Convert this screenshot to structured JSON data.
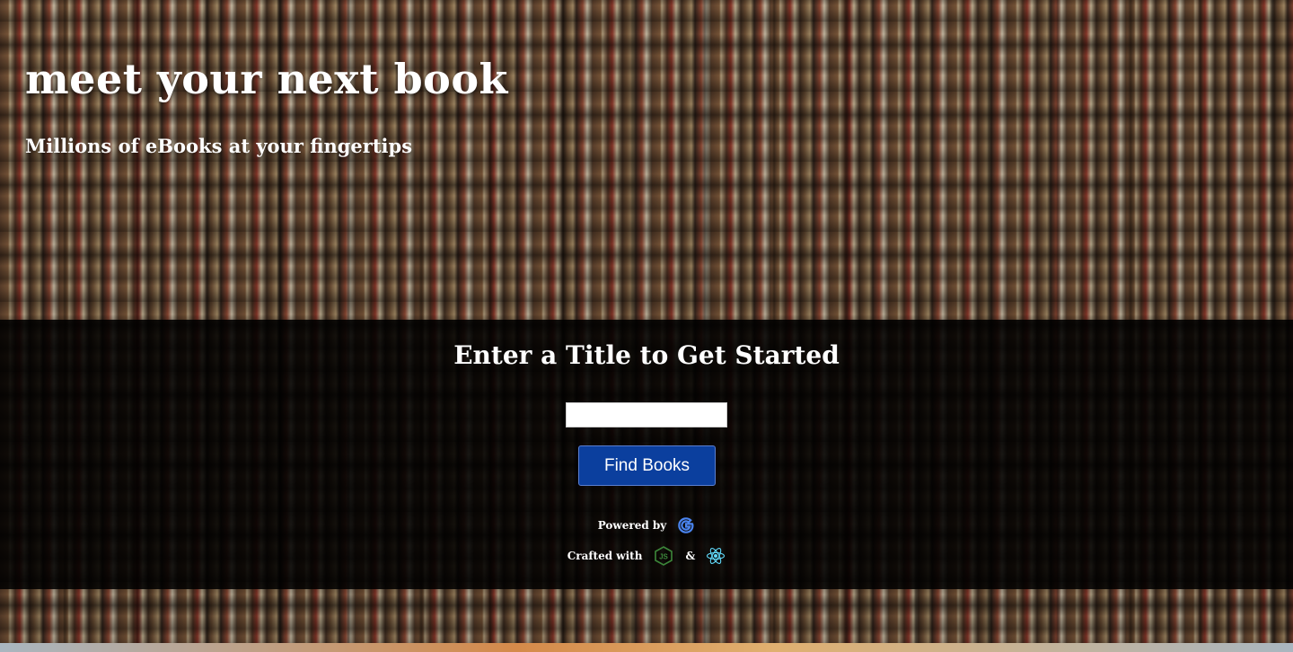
{
  "hero": {
    "title": "meet your next book",
    "subtitle": "Millions of eBooks at your fingertips"
  },
  "search": {
    "heading": "Enter a Title to Get Started",
    "input_value": "",
    "input_placeholder": "",
    "button_label": "Find Books"
  },
  "credits": {
    "powered_by_label": "Powered by",
    "powered_by_icon": "google-icon",
    "crafted_with_label": "Crafted with",
    "crafted_with_icons": [
      "nodejs-icon",
      "react-icon"
    ],
    "separator": "&"
  },
  "colors": {
    "button_bg": "#0b3f9e",
    "panel_bg": "rgba(0,0,0,0.86)",
    "text": "#ffffff",
    "nodejs_green": "#3c873a",
    "react_blue": "#61dafb"
  }
}
